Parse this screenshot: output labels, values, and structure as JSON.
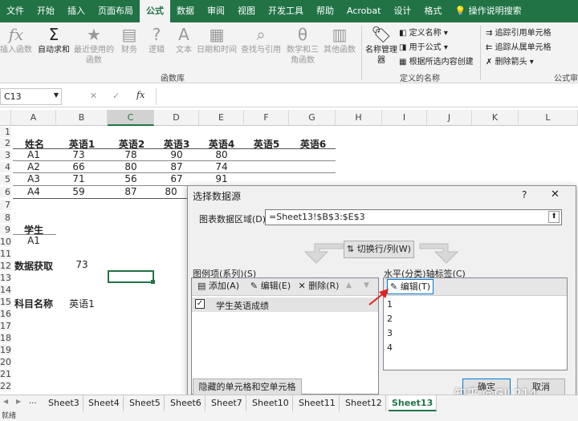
{
  "ribbon": {
    "tabs": [
      "文件",
      "开始",
      "插入",
      "页面布局",
      "公式",
      "数据",
      "审阅",
      "视图",
      "开发工具",
      "帮助",
      "Acrobat",
      "设计",
      "格式"
    ],
    "tell_me": "操作说明搜索"
  },
  "func_lib": {
    "insert": "插入函数",
    "autosum": "自动求和",
    "recent": "最近使用的函数",
    "financial": "财务",
    "logical": "逻辑",
    "text": "文本",
    "datetime": "日期和时间",
    "lookup": "查找与引用",
    "math": "数学和三角函数",
    "other": "其他函数",
    "label": "函数库"
  },
  "names": {
    "manager": "名称管理器",
    "define": "定义名称",
    "use": "用于公式",
    "create": "根据所选内容创建",
    "label": "定义的名称"
  },
  "audit": {
    "trace_prec": "追踪引用单元格",
    "trace_dep": "追踪从属单元格",
    "remove": "删除箭头",
    "label": "公式审"
  },
  "formula_bar": {
    "cell_ref": "C13",
    "fx": "fx"
  },
  "columns": [
    "A",
    "B",
    "C",
    "D",
    "E",
    "F",
    "G",
    "H",
    "I",
    "J",
    "K",
    "L"
  ],
  "rows": [
    "1",
    "2",
    "3",
    "4",
    "5",
    "6",
    "7",
    "8",
    "9",
    "10",
    "11",
    "12",
    "13",
    "14",
    "15",
    "16",
    "17",
    "18",
    "19",
    "20",
    "21",
    "22"
  ],
  "table": {
    "header": [
      "姓名",
      "英语1",
      "英语2",
      "英语3",
      "英语4",
      "英语5",
      "英语6"
    ],
    "data": [
      [
        "A1",
        "73",
        "78",
        "90",
        "80"
      ],
      [
        "A2",
        "66",
        "80",
        "87",
        "74"
      ],
      [
        "A3",
        "71",
        "56",
        "67",
        "91"
      ],
      [
        "A4",
        "59",
        "87",
        "80",
        ""
      ]
    ]
  },
  "extra": {
    "student_label": "学生",
    "student_value": "A1",
    "fetch_label": "数据获取",
    "fetch_value": "73",
    "subject_label": "科目名称",
    "subject_value": "英语1"
  },
  "dialog": {
    "title": "选择数据源",
    "help": "?",
    "close": "✕",
    "range_label": "图表数据区域(D):",
    "range_value": "=Sheet13!$B$3:$E$3",
    "switch": "切换行/列(W)",
    "legend_label": "图例项(系列)(S)",
    "add": "添加(A)",
    "edit": "编辑(E)",
    "delete": "删除(R)",
    "series": [
      "学生英语成绩"
    ],
    "axis_label": "水平(分类)轴标签(C)",
    "axis_edit": "编辑(T)",
    "axis_items": [
      "1",
      "2",
      "3",
      "4"
    ],
    "hidden": "隐藏的单元格和空单元格(H)",
    "ok": "确定",
    "cancel": "取消"
  },
  "sheets": [
    "Sheet3",
    "Sheet4",
    "Sheet5",
    "Sheet6",
    "Sheet7",
    "Sheet10",
    "Sheet11",
    "Sheet12",
    "Sheet13"
  ],
  "active_sheet": "Sheet13",
  "nav": {
    "ellipsis": "..."
  },
  "status": "就绪",
  "watermark": "知乎 @GIL214"
}
